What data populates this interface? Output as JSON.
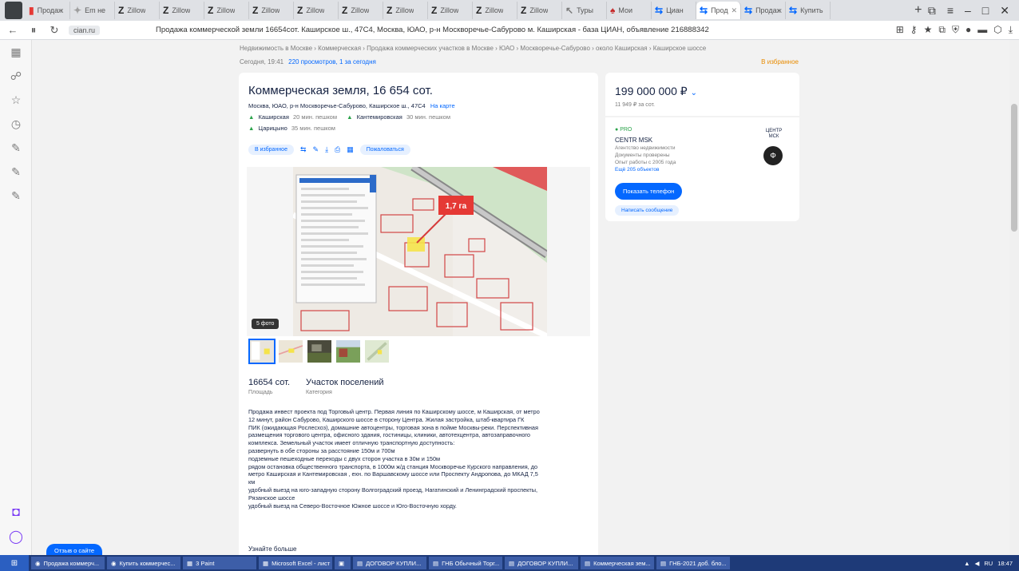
{
  "tabs": [
    {
      "label": "Продаж",
      "fav": "▮",
      "color": "#e53935"
    },
    {
      "label": "Em не",
      "fav": "✦",
      "color": "#9e9e9e"
    },
    {
      "label": "Zillow",
      "fav": "Z",
      "color": "#222222"
    },
    {
      "label": "Zillow",
      "fav": "Z",
      "color": "#222222"
    },
    {
      "label": "Zillow",
      "fav": "Z",
      "color": "#222222"
    },
    {
      "label": "Zillow",
      "fav": "Z",
      "color": "#222222"
    },
    {
      "label": "Zillow",
      "fav": "Z",
      "color": "#222222"
    },
    {
      "label": "Zillow",
      "fav": "Z",
      "color": "#222222"
    },
    {
      "label": "Zillow",
      "fav": "Z",
      "color": "#222222"
    },
    {
      "label": "Zillow",
      "fav": "Z",
      "color": "#222222"
    },
    {
      "label": "Zillow",
      "fav": "Z",
      "color": "#222222"
    },
    {
      "label": "Zillow",
      "fav": "Z",
      "color": "#222222"
    },
    {
      "label": "Туры",
      "fav": "↖",
      "color": "#7a7a7a"
    },
    {
      "label": "Мои",
      "fav": "♠",
      "color": "#c62828"
    },
    {
      "label": "Циан",
      "fav": "⇆",
      "color": "#0468ff"
    },
    {
      "label": "Прод",
      "fav": "⇆",
      "color": "#0468ff",
      "active": true
    },
    {
      "label": "Продаж",
      "fav": "⇆",
      "color": "#0468ff"
    },
    {
      "label": "Купить",
      "fav": "⇆",
      "color": "#0468ff"
    }
  ],
  "addressbar": {
    "host": "cian.ru",
    "page_title": "Продажа коммерческой земли 16654сот. Каширское ш., 47С4, Москва, ЮАО, р-н Москворечье-Сабурово м. Каширская - база ЦИАН, объявление 216888342"
  },
  "breadcrumb": "Недвижимость в Москве › Коммерческая › Продажа коммерческих участков в Москве › ЮАО › Москворечье-Сабурово › около Каширская › Каширское шоссе",
  "meta": {
    "updated": "Сегодня, 19:41",
    "views": "220 просмотров, 1 за сегодня",
    "favorite": "В избранное"
  },
  "listing": {
    "title": "Коммерческая земля, 16 654 сот.",
    "address": "Москва, ЮАО, р-н Москворечье-Сабурово, Каширское ш., 47С4",
    "map_link": "На карте",
    "metro": [
      {
        "name": "Каширская",
        "time": "20 мин. пешком"
      },
      {
        "name": "Кантемировская",
        "time": "30 мин. пешком"
      },
      {
        "name": "Царицыно",
        "time": "35 мин. пешком"
      }
    ],
    "action_favorite": "В избранное",
    "action_report": "Пожаловаться",
    "map_label": "1,7 га",
    "photo_count": "5 фото",
    "area_value": "16654 сот.",
    "area_label": "Площадь",
    "category_value": "Участок поселений",
    "category_label": "Категория",
    "description": [
      "Продажа инвест проекта под Торговый центр. Первая линия по Каширскому шоссе, м Каширская, от метро",
      "12 минут, район Сабурово, Каширского шоссе в сторону Центра. Жилая застройка, штаб-квартира ГК",
      "ПИК (ожидающая Рослесхоз), домашние автоцентры, торговая зона в пойме Москвы-реки. Перспективная",
      "размещения торгового центра, офисного здания, гостиницы, клиники, автотехцентра, автозаправочного",
      "комплекса. Земельный участок имеет отличную транспортную доступность:",
      "развернуть в обе стороны за расстояние 150м и 700м",
      "подземные пешеходные переходы с двух сторон участка в 30м и 150м",
      "рядом остановка общественного транспорта, в 1000м ж/д станция Москворечье Курского направления, до",
      "метро Каширская и Кантемировская , ехн. по Варшавскому шоссе или Проспекту Андропова, до МКАД 7,5",
      "км",
      "удобный выезд на юго-западную сторону Волгоградский проезд, Нагатинский и Ленинградский проспекты,",
      "Рязанское шоссе",
      "удобный выезд на Северо-Восточное Южное шоссе и Юго-Восточную хорду."
    ],
    "more_header": "Узнайте больше"
  },
  "price": {
    "value": "199 000 000 ₽",
    "per_unit": "11 949 ₽ за сот."
  },
  "agent": {
    "badge": "PRO",
    "name": "CENTR MSK",
    "line1": "Агентство недвижимости",
    "line2": "Документы проверены",
    "line3": "Опыт работы с 2005 года",
    "objects": "Ещё 205 объектов",
    "logo_label": "ЦЕНТР МСК",
    "logo_glyph": "Ф",
    "phone_button": "Показать телефон",
    "message_button": "Написать сообщение"
  },
  "chat_label": "Отзыв о сайте",
  "taskbar": {
    "start": "⊞",
    "items": [
      {
        "label": "Продажа коммерч...",
        "icon": "◉"
      },
      {
        "label": "Купить коммерчес...",
        "icon": "◉"
      },
      {
        "label": "3 Paint",
        "icon": "▦"
      },
      {
        "label": "Microsoft Excel - лист",
        "icon": "▦"
      },
      {
        "label": "",
        "icon": "▣"
      },
      {
        "label": "ДОГОВОР КУПЛИ...",
        "icon": "▤"
      },
      {
        "label": "ГНБ Обычный Торг...",
        "icon": "▤"
      },
      {
        "label": "ДОГОВОР КУПЛИ...",
        "icon": "▤"
      },
      {
        "label": "Коммерческая зем...",
        "icon": "▤"
      },
      {
        "label": "ГНБ-2021 доб. бло...",
        "icon": "▤"
      }
    ],
    "tray_lang": "RU",
    "clock": "18:47"
  }
}
